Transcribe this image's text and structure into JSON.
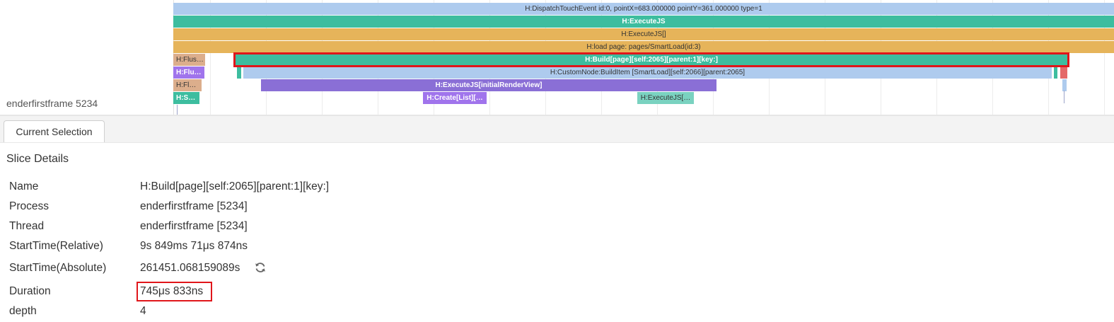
{
  "track": {
    "name": "enderfirstframe 5234"
  },
  "colors": {
    "light_blue": "#aecbee",
    "teal": "#3dbd9f",
    "gold": "#e6b45a",
    "tan": "#dcae8c",
    "violet": "#a074ec",
    "purple": "#8a6fd6",
    "teal_light": "#7ad2c0",
    "red": "#e46969",
    "highlight": "#e0161b"
  },
  "slices": {
    "dispatch": "H:DispatchTouchEvent id:0, pointX=683.000000 pointY=361.000000 type=1",
    "execute_js": "H:ExecuteJS",
    "execute_js_brackets": "H:ExecuteJS[]",
    "load_page": "H:load page: pages/SmartLoad(id:3)",
    "flush_1": "H:Flus…",
    "build_page": "H:Build[page][self:2065][parent:1][key:]",
    "flu_2": "H:Flu…",
    "custom_node": "H:CustomNode:BuildItem [SmartLoad][self:2066][parent:2065]",
    "fl_3": "H:Fl…",
    "execute_js_initial": "H:ExecuteJS[initialRenderView]",
    "s_4": "H:S…",
    "create_list": "H:Create[List][…",
    "execute_js_short": "H:ExecuteJS[…"
  },
  "panel": {
    "tab_label": "Current Selection",
    "section_title": "Slice Details",
    "rows": [
      {
        "key": "Name",
        "value": "H:Build[page][self:2065][parent:1][key:]"
      },
      {
        "key": "Process",
        "value": "enderfirstframe [5234]"
      },
      {
        "key": "Thread",
        "value": "enderfirstframe [5234]"
      },
      {
        "key": "StartTime(Relative)",
        "value": "9s 849ms 71μs 874ns"
      },
      {
        "key": "StartTime(Absolute)",
        "value": "261451.068159089s"
      },
      {
        "key": "Duration",
        "value": "745μs 833ns"
      },
      {
        "key": "depth",
        "value": "4"
      }
    ],
    "icons": {
      "refresh": "refresh-icon"
    }
  }
}
